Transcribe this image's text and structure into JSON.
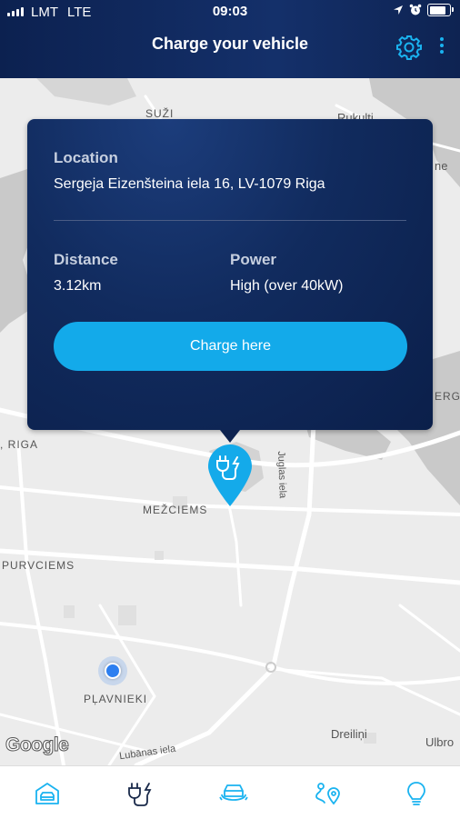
{
  "status": {
    "carrier": "LMT",
    "network": "LTE",
    "time": "09:03",
    "battery_level": 0.9
  },
  "header": {
    "title": "Charge your vehicle",
    "settings_icon": "gear-icon",
    "more_icon": "more-vertical-icon"
  },
  "map": {
    "labels": {
      "suzi": "SUŽI",
      "rukulti": "Rukulti",
      "ne": "ne",
      "erg": "ERG",
      "riga": ", RIGA",
      "mezciems": "MEŽCIEMS",
      "purvciems": "PURVCIEMS",
      "plavnieki": "PĻAVNIEKI",
      "dreilini": "Dreiliņi",
      "ulbro": "Ulbro",
      "juglas_iela": "Juglas iela",
      "lubanas_iela": "Lubānas iela"
    },
    "attribution": "Google",
    "pin_icon": "charging-plug-icon"
  },
  "popup": {
    "location_label": "Location",
    "location_value": "Sergeja Eizenšteina iela 16, LV-1079 Riga",
    "distance_label": "Distance",
    "distance_value": "3.12km",
    "power_label": "Power",
    "power_value": "High (over 40kW)",
    "cta": "Charge here"
  },
  "nav": [
    {
      "icon": "garage-car-icon"
    },
    {
      "icon": "charging-plug-icon"
    },
    {
      "icon": "car-service-icon"
    },
    {
      "icon": "route-pin-icon"
    },
    {
      "icon": "lightbulb-icon"
    }
  ],
  "colors": {
    "header_bg": "#0c2150",
    "accent": "#13aaea",
    "popup_bg": "#0b1f4a"
  }
}
